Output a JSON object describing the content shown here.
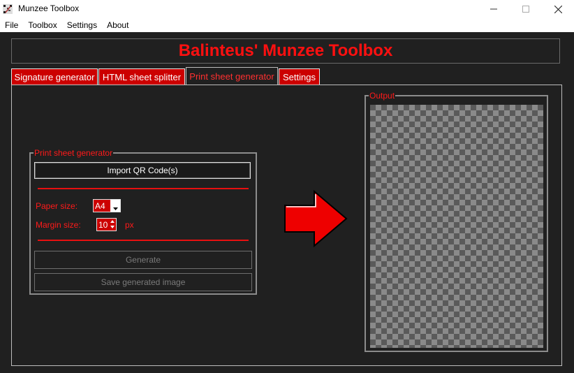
{
  "window": {
    "title": "Munzee Toolbox",
    "controls": {
      "minimize": "minimize-icon",
      "maximize": "maximize-icon",
      "close": "close-icon"
    }
  },
  "menu": [
    "File",
    "Toolbox",
    "Settings",
    "About"
  ],
  "header": {
    "title": "Balinteus' Munzee Toolbox"
  },
  "tabs": [
    {
      "label": "Signature generator",
      "active": false
    },
    {
      "label": "HTML sheet splitter",
      "active": false
    },
    {
      "label": "Print sheet generator",
      "active": true
    },
    {
      "label": "Settings",
      "active": false
    }
  ],
  "generator": {
    "group_title": "Print sheet generator",
    "import_button": "Import QR Code(s)",
    "paper_size_label": "Paper size:",
    "paper_size_value": "A4",
    "margin_size_label": "Margin size:",
    "margin_size_value": "10",
    "margin_unit": "px",
    "generate_button": "Generate",
    "save_button": "Save generated image"
  },
  "output": {
    "group_title": "Output"
  },
  "colors": {
    "accent": "#cc0000",
    "text_red": "#ff1a1a",
    "background": "#202020"
  }
}
